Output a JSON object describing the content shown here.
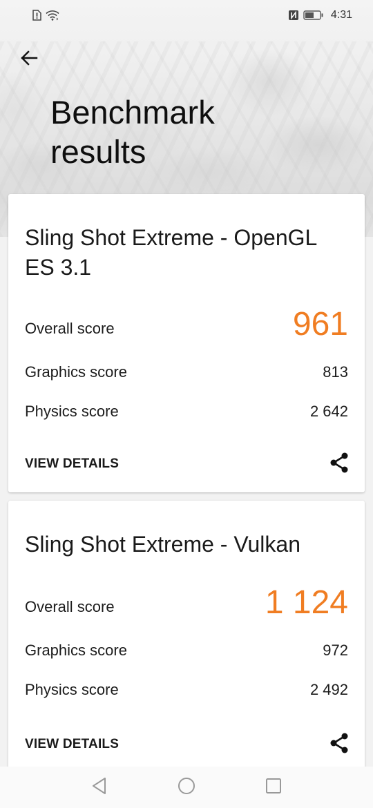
{
  "status_bar": {
    "left_icons": [
      "sim-alert-icon",
      "wifi-icon"
    ],
    "right_icons": [
      "nfc-icon",
      "battery-icon"
    ],
    "time": "4:31",
    "battery_level": 0.55
  },
  "header": {
    "back_icon": "arrow-left-icon",
    "title": "Benchmark results"
  },
  "accent_color": "#f07d22",
  "results": [
    {
      "title": "Sling Shot Extreme - OpenGL ES 3.1",
      "overall_label": "Overall score",
      "overall_value": "961",
      "graphics_label": "Graphics score",
      "graphics_value": "813",
      "physics_label": "Physics score",
      "physics_value": "2 642",
      "details_label": "VIEW DETAILS",
      "share_icon": "share-icon"
    },
    {
      "title": "Sling Shot Extreme - Vulkan",
      "overall_label": "Overall score",
      "overall_value": "1 124",
      "graphics_label": "Graphics score",
      "graphics_value": "972",
      "physics_label": "Physics score",
      "physics_value": "2 492",
      "details_label": "VIEW DETAILS",
      "share_icon": "share-icon"
    }
  ],
  "nav_bar": {
    "buttons": [
      "back-triangle-icon",
      "home-circle-icon",
      "recents-square-icon"
    ]
  }
}
